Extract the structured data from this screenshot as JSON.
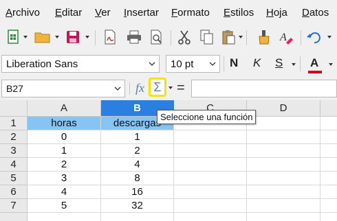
{
  "menu": [
    {
      "name": "menu-archivo",
      "u": "A",
      "rest": "rchivo"
    },
    {
      "name": "menu-editar",
      "u": "E",
      "rest": "ditar"
    },
    {
      "name": "menu-ver",
      "u": "V",
      "rest": "er"
    },
    {
      "name": "menu-insertar",
      "u": "I",
      "rest": "nsertar"
    },
    {
      "name": "menu-formato",
      "u": "F",
      "rest": "ormato"
    },
    {
      "name": "menu-estilos",
      "u": "E",
      "rest": "stilos"
    },
    {
      "name": "menu-hoja",
      "u": "H",
      "rest": "oja"
    },
    {
      "name": "menu-datos",
      "u": "D",
      "rest": "atos"
    }
  ],
  "toolbar2": {
    "font_name": "Liberation Sans",
    "font_size": "10 pt",
    "bold": "N",
    "italic": "K",
    "underline": "S",
    "font_color_letter": "A"
  },
  "formula_bar": {
    "name_box": "B27",
    "fx": "fx",
    "sigma": "Σ",
    "equals": "=",
    "formula": ""
  },
  "columns": [
    "A",
    "B",
    "C",
    "D"
  ],
  "selected_column": "B",
  "rows": [
    {
      "n": "1",
      "a": "horas",
      "b": "descargas"
    },
    {
      "n": "2",
      "a": "0",
      "b": "1"
    },
    {
      "n": "3",
      "a": "1",
      "b": "2"
    },
    {
      "n": "4",
      "a": "2",
      "b": "4"
    },
    {
      "n": "5",
      "a": "3",
      "b": "8"
    },
    {
      "n": "6",
      "a": "4",
      "b": "16"
    },
    {
      "n": "7",
      "a": "5",
      "b": "32"
    }
  ],
  "tooltip": "Seleccione una función",
  "colors": {
    "selected_header": "#2a7fe0",
    "header_cell_fill": "#86c5f3",
    "sigma_highlight": "#f5e400",
    "font_color_bar": "#d0021b"
  }
}
